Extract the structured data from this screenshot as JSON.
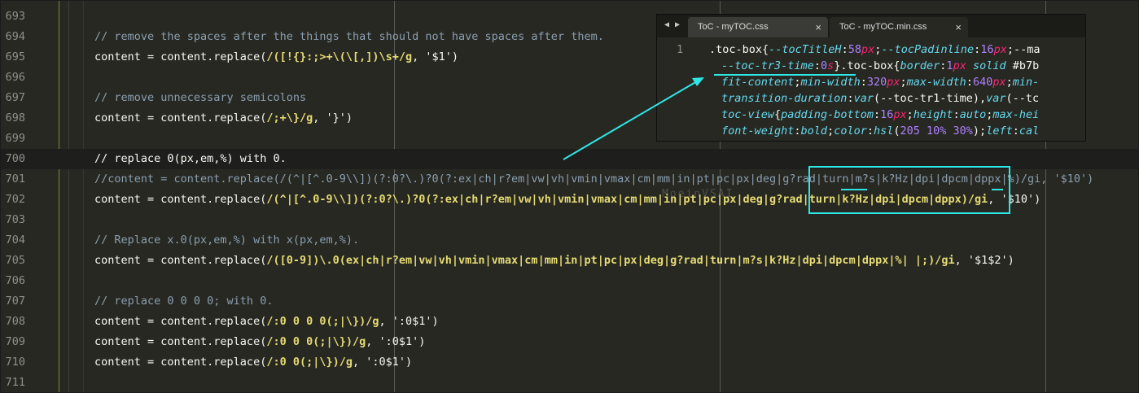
{
  "editor": {
    "lines": [
      {
        "num": "693",
        "segments": []
      },
      {
        "num": "694",
        "segments": [
          {
            "cls": "cm",
            "text": "// remove the spaces after the things that should not have spaces after them."
          }
        ]
      },
      {
        "num": "695",
        "segments": [
          {
            "cls": "",
            "text": "content = content.replace("
          },
          {
            "cls": "rx",
            "text": "/([!{}:;>+\\(\\[,])\\s+/g"
          },
          {
            "cls": "",
            "text": ", '$1')"
          }
        ]
      },
      {
        "num": "696",
        "segments": []
      },
      {
        "num": "697",
        "segments": [
          {
            "cls": "cm",
            "text": "// remove unnecessary semicolons"
          }
        ]
      },
      {
        "num": "698",
        "segments": [
          {
            "cls": "",
            "text": "content = content.replace("
          },
          {
            "cls": "rx",
            "text": "/;+\\}/g"
          },
          {
            "cls": "",
            "text": ", '}')"
          }
        ]
      },
      {
        "num": "699",
        "segments": []
      },
      {
        "num": "700",
        "segments": [
          {
            "cls": "",
            "text": "// replace 0(px,em,%) with 0."
          }
        ]
      },
      {
        "num": "701",
        "segments": [
          {
            "cls": "cm",
            "text": "//content = content.replace(/(^|[^.0-9\\\\])(?:0?\\.)?0(?:ex|ch|r?em|vw|vh|vmin|vmax|cm|mm|in|pt|pc|px|deg|g?rad|turn|m?s|k?Hz|dpi|dpcm|dppx|%)/gi, '$10')"
          }
        ]
      },
      {
        "num": "702",
        "segments": [
          {
            "cls": "",
            "text": "content = content.replace("
          },
          {
            "cls": "rx",
            "text": "/(^|[^.0-9\\\\])(?:0?\\.)?0(?:ex|ch|r?em|vw|vh|vmin|vmax|cm|mm|in|pt|pc|px|deg|g?rad|turn|k?Hz|dpi|dpcm|dppx)/gi"
          },
          {
            "cls": "",
            "text": ", '$10')"
          }
        ]
      },
      {
        "num": "703",
        "segments": []
      },
      {
        "num": "704",
        "segments": [
          {
            "cls": "cm",
            "text": "// Replace x.0(px,em,%) with x(px,em,%)."
          }
        ]
      },
      {
        "num": "705",
        "segments": [
          {
            "cls": "",
            "text": "content = content.replace("
          },
          {
            "cls": "rx",
            "text": "/([0-9])\\.0(ex|ch|r?em|vw|vh|vmin|vmax|cm|mm|in|pt|pc|px|deg|g?rad|turn|m?s|k?Hz|dpi|dpcm|dppx|%| |;)/gi"
          },
          {
            "cls": "",
            "text": ", '$1$2')"
          }
        ]
      },
      {
        "num": "706",
        "segments": []
      },
      {
        "num": "707",
        "segments": [
          {
            "cls": "cm",
            "text": "// replace 0 0 0 0; with 0."
          }
        ]
      },
      {
        "num": "708",
        "segments": [
          {
            "cls": "",
            "text": "content = content.replace("
          },
          {
            "cls": "rx",
            "text": "/:0 0 0 0(;|\\})/g"
          },
          {
            "cls": "",
            "text": ", ':0$1')"
          }
        ]
      },
      {
        "num": "709",
        "segments": [
          {
            "cls": "",
            "text": "content = content.replace("
          },
          {
            "cls": "rx",
            "text": "/:0 0 0(;|\\})/g"
          },
          {
            "cls": "",
            "text": ", ':0$1')"
          }
        ]
      },
      {
        "num": "710",
        "segments": [
          {
            "cls": "",
            "text": "content = content.replace("
          },
          {
            "cls": "rx",
            "text": "/:0 0(;|\\})/g"
          },
          {
            "cls": "",
            "text": ", ':0$1')"
          }
        ]
      },
      {
        "num": "711",
        "segments": []
      }
    ],
    "current_line": "700",
    "ghost_text": "MoeinVSAI"
  },
  "inset": {
    "nav": {
      "prev": "◀",
      "next": "▶"
    },
    "tabs": [
      {
        "label": "ToC - myTOC.css",
        "close": "×"
      },
      {
        "label": "ToC - myTOC.min.css",
        "close": "×",
        "active": true
      }
    ],
    "line_number": "1",
    "code_lines": [
      [
        {
          "c": "sel",
          "t": ".toc-box{"
        },
        {
          "c": "prop",
          "t": "--tocTitleH"
        },
        {
          "c": "pu",
          "t": ":"
        },
        {
          "c": "num",
          "t": "58"
        },
        {
          "c": "unit",
          "t": "px"
        },
        {
          "c": "pu",
          "t": ";"
        },
        {
          "c": "prop",
          "t": "--tocPadinline"
        },
        {
          "c": "pu",
          "t": ":"
        },
        {
          "c": "num",
          "t": "16"
        },
        {
          "c": "unit",
          "t": "px"
        },
        {
          "c": "pu",
          "t": ";--ma"
        }
      ],
      [
        {
          "c": "prop",
          "t": "--toc-tr3-time"
        },
        {
          "c": "pu",
          "t": ":"
        },
        {
          "c": "num",
          "t": "0"
        },
        {
          "c": "unit",
          "t": "s"
        },
        {
          "c": "pu",
          "t": "}.toc-box{"
        },
        {
          "c": "prop",
          "t": "border"
        },
        {
          "c": "pu",
          "t": ":"
        },
        {
          "c": "num",
          "t": "1"
        },
        {
          "c": "unit",
          "t": "px"
        },
        {
          "c": "prop",
          "t": " solid"
        },
        {
          "c": "pu",
          "t": " #b7b"
        }
      ],
      [
        {
          "c": "prop",
          "t": "fit-content"
        },
        {
          "c": "pu",
          "t": ";"
        },
        {
          "c": "prop",
          "t": "min-width"
        },
        {
          "c": "pu",
          "t": ":"
        },
        {
          "c": "num",
          "t": "320"
        },
        {
          "c": "unit",
          "t": "px"
        },
        {
          "c": "pu",
          "t": ";"
        },
        {
          "c": "prop",
          "t": "max-width"
        },
        {
          "c": "pu",
          "t": ":"
        },
        {
          "c": "num",
          "t": "640"
        },
        {
          "c": "unit",
          "t": "px"
        },
        {
          "c": "pu",
          "t": ";"
        },
        {
          "c": "prop",
          "t": "min-"
        }
      ],
      [
        {
          "c": "prop",
          "t": "transition-duration"
        },
        {
          "c": "pu",
          "t": ":"
        },
        {
          "c": "fn",
          "t": "var"
        },
        {
          "c": "pu",
          "t": "(--toc-tr1-time),"
        },
        {
          "c": "fn",
          "t": "var"
        },
        {
          "c": "pu",
          "t": "(--tc"
        }
      ],
      [
        {
          "c": "prop",
          "t": "toc-view"
        },
        {
          "c": "pu",
          "t": "{"
        },
        {
          "c": "prop",
          "t": "padding-bottom"
        },
        {
          "c": "pu",
          "t": ":"
        },
        {
          "c": "num",
          "t": "16"
        },
        {
          "c": "unit",
          "t": "px"
        },
        {
          "c": "pu",
          "t": ";"
        },
        {
          "c": "prop",
          "t": "height"
        },
        {
          "c": "pu",
          "t": ":"
        },
        {
          "c": "prop",
          "t": "auto"
        },
        {
          "c": "pu",
          "t": ";"
        },
        {
          "c": "prop",
          "t": "max-hei"
        }
      ],
      [
        {
          "c": "prop",
          "t": "font-weight"
        },
        {
          "c": "pu",
          "t": ":"
        },
        {
          "c": "prop",
          "t": "bold"
        },
        {
          "c": "pu",
          "t": ";"
        },
        {
          "c": "prop",
          "t": "color"
        },
        {
          "c": "pu",
          "t": ":"
        },
        {
          "c": "fn",
          "t": "hsl"
        },
        {
          "c": "pu",
          "t": "("
        },
        {
          "c": "num",
          "t": "205 10% 30%"
        },
        {
          "c": "pu",
          "t": ");"
        },
        {
          "c": "prop",
          "t": "left"
        },
        {
          "c": "pu",
          "t": ":"
        },
        {
          "c": "fn",
          "t": "cal"
        }
      ]
    ]
  },
  "colors": {
    "highlight": "#2ee6e6",
    "comment": "#8b9fb0",
    "regex": "#e6db74"
  }
}
